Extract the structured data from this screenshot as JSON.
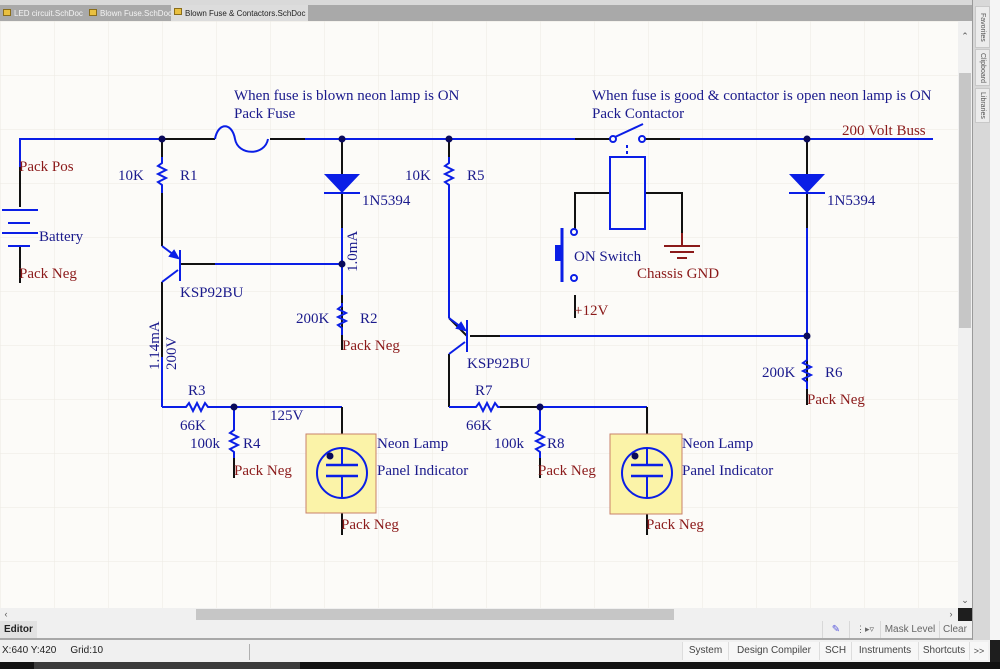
{
  "tabs": [
    {
      "label": "LED circuit.SchDoc",
      "active": false
    },
    {
      "label": "Blown Fuse.SchDoc",
      "active": false
    },
    {
      "label": "Blown Fuse & Contactors.SchDoc",
      "active": true
    }
  ],
  "side_panels": [
    "Favorites",
    "Clipboard",
    "Libraries"
  ],
  "schematic": {
    "notes": {
      "fuse_note": "When fuse is blown neon lamp is ON",
      "contactor_note": "When fuse is good & contactor is open neon lamp is ON"
    },
    "components": {
      "fuse": "Pack Fuse",
      "contactor": "Pack Contactor",
      "battery": "Battery",
      "r1": {
        "designator": "R1",
        "value": "10K"
      },
      "r2": {
        "designator": "R2",
        "value": "200K"
      },
      "r3": {
        "designator": "R3",
        "value": "66K"
      },
      "r4": {
        "designator": "R4",
        "value": "100k"
      },
      "r5": {
        "designator": "R5",
        "value": "10K"
      },
      "r6": {
        "designator": "R6",
        "value": "200K"
      },
      "r7": {
        "designator": "R7",
        "value": "66K"
      },
      "r8": {
        "designator": "R8",
        "value": "100k"
      },
      "d1": "1N5394",
      "d2": "1N5394",
      "q1": "KSP92BU",
      "q2": "KSP92BU",
      "lamp1": {
        "name": "Neon Lamp",
        "desc": "Panel Indicator"
      },
      "lamp2": {
        "name": "Neon Lamp",
        "desc": "Panel Indicator"
      },
      "switch": "ON Switch"
    },
    "net_labels": {
      "pack_pos": "Pack Pos",
      "pack_neg": "Pack Neg",
      "bus": "200 Volt Buss",
      "chassis_gnd": "Chassis GND",
      "plus12": "+12V"
    },
    "annotations": {
      "current_1": "1.0mA",
      "current_2": "1.14mA",
      "voltage_1": "200V",
      "voltage_2": "125V"
    }
  },
  "editor_bar": {
    "tab": "Editor",
    "mask_level": "Mask Level",
    "clear": "Clear"
  },
  "status": {
    "coords": "X:640 Y:420",
    "grid": "Grid:10",
    "buttons": [
      "System",
      "Design Compiler",
      "SCH",
      "Instruments",
      "Shortcuts",
      ">>"
    ]
  },
  "colors": {
    "wire": "#0a1ee6",
    "junction": "#0a0a5a",
    "label_blue": "#1a1a8c",
    "net_red": "#8b1a1a",
    "grid": "#ece9e2",
    "lamp_fill": "#fbf3a8"
  }
}
